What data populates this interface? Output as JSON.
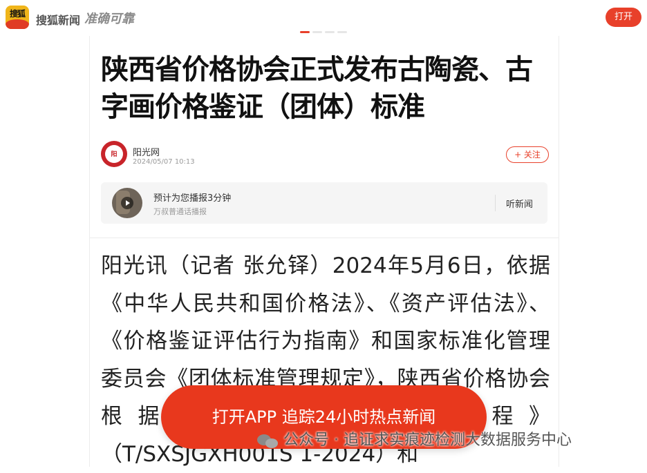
{
  "header": {
    "logo_text": "搜狐",
    "brand": "搜狐新闻",
    "slogan": "准确可靠",
    "open_label": "打开"
  },
  "article": {
    "title": "陕西省价格协会正式发布古陶瓷、古字画价格鉴证（团体）标准",
    "author": {
      "name": "阳光网",
      "date": "2024/05/07 10:13",
      "follow_label": "+ 关注"
    },
    "audio": {
      "title": "预计为您播报3分钟",
      "subtitle": "万叔普通话播报",
      "listen_label": "听新闻"
    },
    "body": "阳光讯（记者 张允铎）2024年5月6日，依据《中华人民共和国价格法》、《资产评估法》、《价格鉴证评估行为指南》和国家标准化管理委员会《团体标准管理规定》，陕西省价格协会根据……依据价格鉴证规程》（T/SXSJGXH001S 1-2024）和"
  },
  "cta": {
    "label": "打开APP 追踪24小时热点新闻"
  },
  "watermark": {
    "text": "公众号 · 追证求实痕迹检测大数据服务中心"
  },
  "colors": {
    "accent": "#e8402a",
    "cta": "#e8381d"
  }
}
